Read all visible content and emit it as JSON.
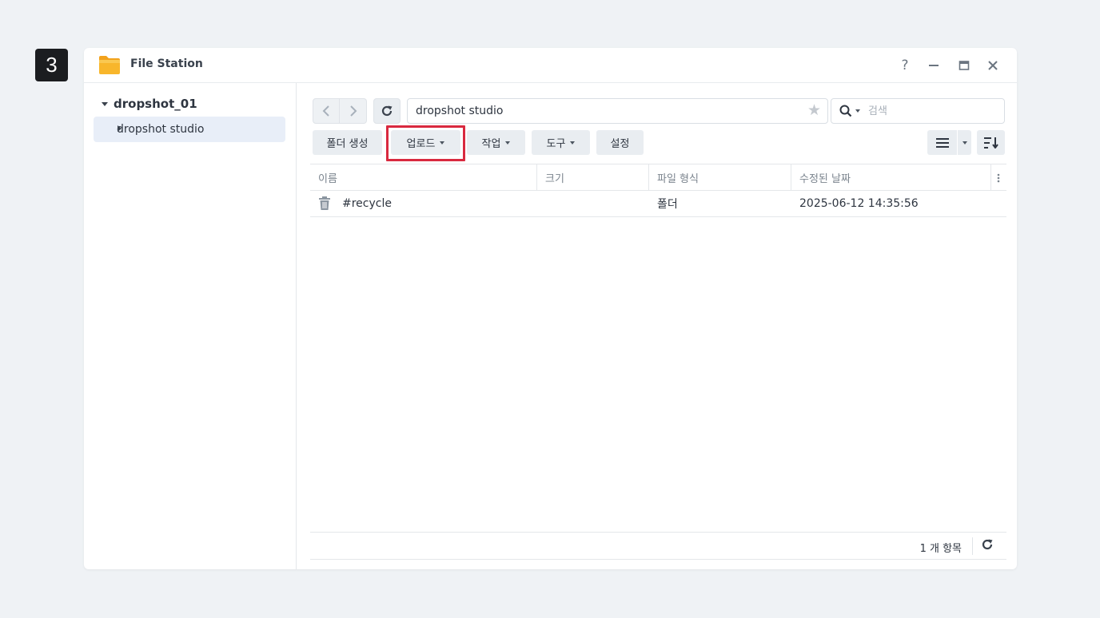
{
  "step_badge": "3",
  "window": {
    "title": "File Station",
    "controls": {
      "help": "?",
      "minimize": "—",
      "maximize": "▭",
      "close": "✕"
    }
  },
  "sidebar": {
    "root": "dropshot_01",
    "items": [
      {
        "label": "dropshot studio"
      }
    ]
  },
  "toolbar": {
    "path": "dropshot studio",
    "search_placeholder": "검색",
    "buttons": {
      "new_folder": "폴더 생성",
      "upload": "업로드",
      "action": "작업",
      "tools": "도구",
      "settings": "설정"
    }
  },
  "grid": {
    "columns": [
      "이름",
      "크기",
      "파일 형식",
      "수정된 날짜"
    ],
    "rows": [
      {
        "name": "#recycle",
        "size": "",
        "type": "폴더",
        "modified": "2025-06-12 14:35:56",
        "icon": "trash-icon"
      }
    ]
  },
  "status": {
    "count": "1 개 항목"
  },
  "colors": {
    "highlight": "#d9293f",
    "selected_bg": "#e8eef8",
    "button_bg": "#e9edf1"
  }
}
